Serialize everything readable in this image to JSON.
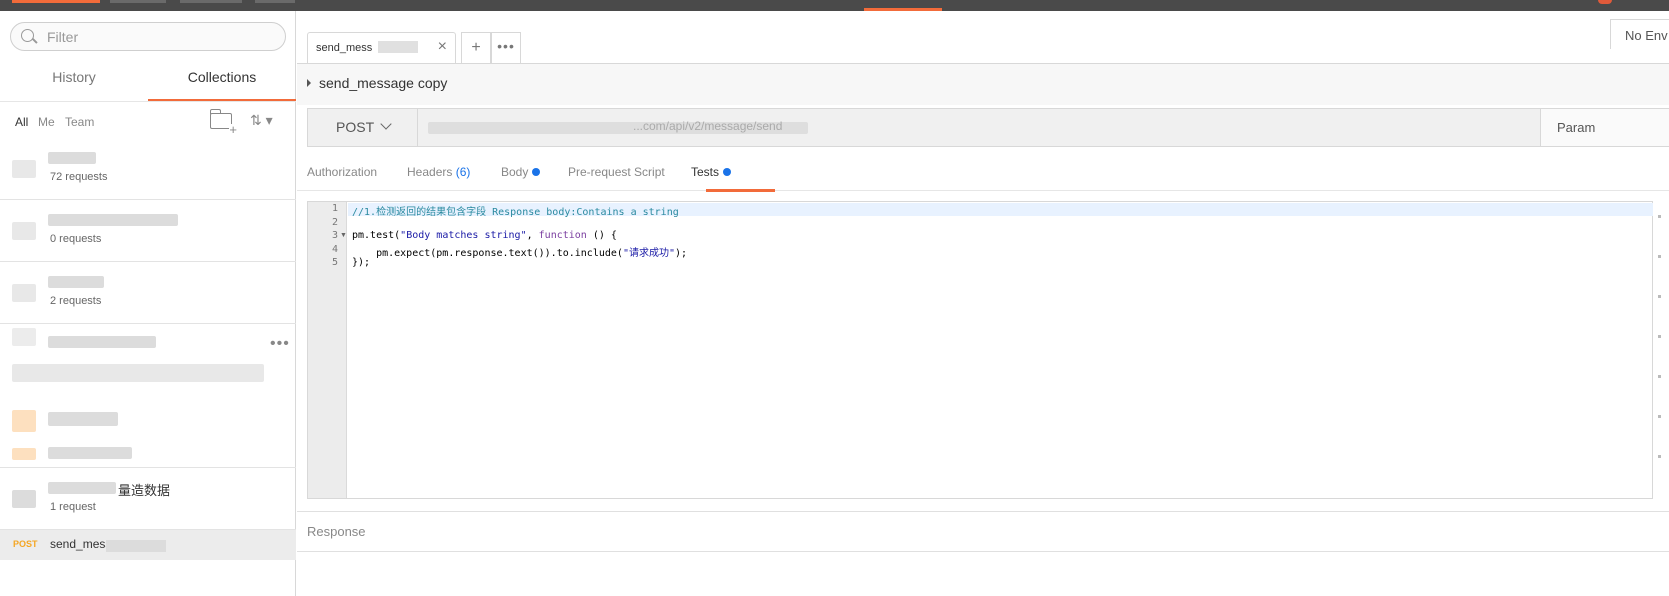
{
  "sidebar": {
    "filter_placeholder": "Filter",
    "tabs": [
      {
        "label": "History"
      },
      {
        "label": "Collections"
      }
    ],
    "filters": [
      {
        "label": "All"
      },
      {
        "label": "Me"
      },
      {
        "label": "Team"
      }
    ],
    "collections": [
      {
        "count": "72 requests"
      },
      {
        "count": "0 requests"
      },
      {
        "count": "2 requests"
      },
      {
        "name": "量造数据",
        "count": "1 request"
      }
    ],
    "request": {
      "method": "POST",
      "name": "send_mess"
    }
  },
  "main": {
    "tab_label": "send_mess",
    "env_label": "No Env",
    "request_name": "send_message copy",
    "method": "POST",
    "url_visible": "...com/api/v2/message/send",
    "params_label": "Param",
    "request_tabs": [
      {
        "label": "Authorization"
      },
      {
        "label": "Headers",
        "count": "(6)"
      },
      {
        "label": "Body"
      },
      {
        "label": "Pre-request Script"
      },
      {
        "label": "Tests"
      }
    ],
    "code": {
      "line_numbers": [
        "1",
        "2",
        "3",
        "4",
        "5"
      ],
      "line1": "//1.检测返回的结果包含字段 Response body:Contains a string",
      "line3_a": "pm.test(",
      "line3_b": "\"Body matches string\"",
      "line3_c": ", ",
      "line3_d": "function",
      "line3_e": " () {",
      "line4_a": "    pm.expect(pm.response.text()).to.include(",
      "line4_b": "\"请求成功\"",
      "line4_c": ");",
      "line5": "});"
    },
    "response_label": "Response"
  },
  "colors": {
    "accent": "#f26b3a",
    "method_post": "#f5a623",
    "dot": "#1a73e8"
  }
}
